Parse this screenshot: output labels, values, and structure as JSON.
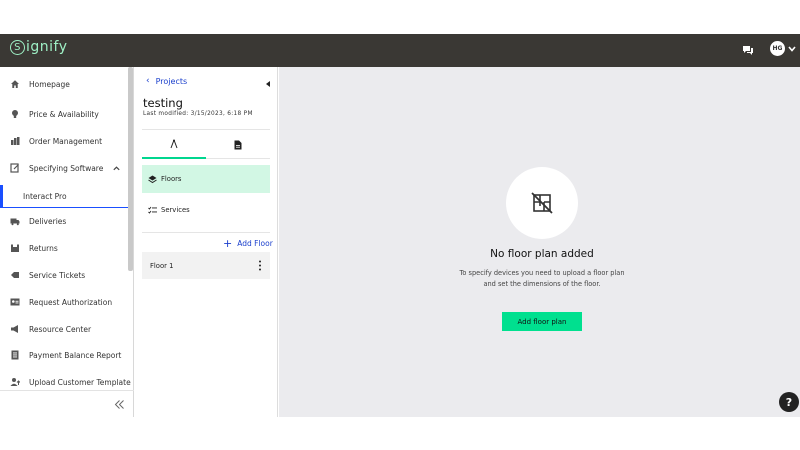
{
  "header": {
    "logo_text": "ignify",
    "logo_mark": "S",
    "avatar_initials": "HG",
    "icons": [
      "chat-icon",
      "chevron-down-icon"
    ]
  },
  "sidebar": {
    "items": [
      {
        "label": "Homepage",
        "icon": "home-icon"
      },
      {
        "label": "Price & Availability",
        "icon": "lightbulb-icon"
      },
      {
        "label": "Order Management",
        "icon": "order-icon"
      },
      {
        "label": "Specifying Software",
        "icon": "software-icon",
        "expanded": true
      },
      {
        "label": "Interact Pro",
        "active": true
      },
      {
        "label": "Deliveries",
        "icon": "truck-icon"
      },
      {
        "label": "Returns",
        "icon": "returns-icon"
      },
      {
        "label": "Service Tickets",
        "icon": "ticket-icon"
      },
      {
        "label": "Request Authorization",
        "icon": "authorization-icon"
      },
      {
        "label": "Resource Center",
        "icon": "megaphone-icon"
      },
      {
        "label": "Payment Balance Report",
        "icon": "report-icon"
      },
      {
        "label": "Upload Customer Template",
        "icon": "upload-user-icon"
      }
    ],
    "collapse_icon": "double-chevron-left-icon"
  },
  "panel": {
    "back_label": "Projects",
    "project_name": "testing",
    "last_modified": "Last modified: 3/15/2023, 6:18 PM",
    "tabs": [
      {
        "icon": "compass-icon",
        "active": true
      },
      {
        "icon": "document-icon",
        "active": false
      }
    ],
    "nav": [
      {
        "label": "Floors",
        "icon": "layers-icon",
        "active": true
      },
      {
        "label": "Services",
        "icon": "checklist-icon",
        "active": false
      }
    ],
    "add_floor_label": "Add Floor",
    "floors": [
      {
        "label": "Floor 1"
      }
    ]
  },
  "main": {
    "empty_icon": "no-floorplan-icon",
    "empty_title": "No floor plan added",
    "empty_desc_line1": "To specify devices you need to upload a floor plan",
    "empty_desc_line2": "and set the dimensions of the floor.",
    "add_plan_label": "Add floor plan",
    "help_label": "?"
  },
  "colors": {
    "topbar": "#3a3834",
    "brand_green": "#00e08f",
    "logo_green": "#9ef0c5",
    "link_blue": "#1a3fcc",
    "active_row": "#d2f7e4",
    "main_bg": "#ebebee"
  }
}
